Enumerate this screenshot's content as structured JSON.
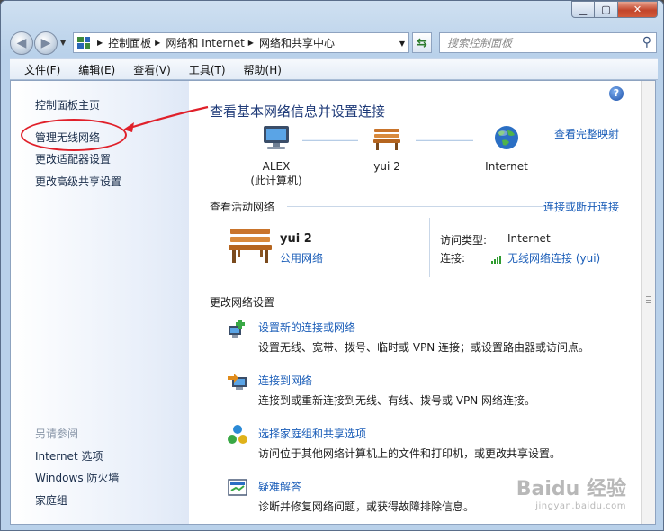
{
  "address": {
    "crumbs": [
      "控制面板",
      "网络和 Internet",
      "网络和共享中心"
    ],
    "search_placeholder": "搜索控制面板"
  },
  "menu": [
    "文件(F)",
    "编辑(E)",
    "查看(V)",
    "工具(T)",
    "帮助(H)"
  ],
  "sidebar": {
    "links": [
      "控制面板主页",
      "管理无线网络",
      "更改适配器设置",
      "更改高级共享设置"
    ],
    "see_also_heading": "另请参阅",
    "see_also": [
      "Internet 选项",
      "Windows 防火墙",
      "家庭组"
    ]
  },
  "main": {
    "title": "查看基本网络信息并设置连接",
    "full_map_link": "查看完整映射",
    "nodes": [
      {
        "name": "ALEX",
        "sub": "(此计算机)"
      },
      {
        "name": "yui  2",
        "sub": ""
      },
      {
        "name": "Internet",
        "sub": ""
      }
    ],
    "active_heading": "查看活动网络",
    "connect_toggle": "连接或断开连接",
    "active_network": {
      "name": "yui  2",
      "category": "公用网络",
      "access_label": "访问类型:",
      "access_value": "Internet",
      "connection_label": "连接:",
      "connection_value": "无线网络连接 (yui)"
    },
    "change_heading": "更改网络设置",
    "tasks": [
      {
        "title": "设置新的连接或网络",
        "desc": "设置无线、宽带、拨号、临时或 VPN 连接；或设置路由器或访问点。"
      },
      {
        "title": "连接到网络",
        "desc": "连接到或重新连接到无线、有线、拨号或 VPN 网络连接。"
      },
      {
        "title": "选择家庭组和共享选项",
        "desc": "访问位于其他网络计算机上的文件和打印机，或更改共享设置。"
      },
      {
        "title": "疑难解答",
        "desc": "诊断并修复网络问题，或获得故障排除信息。"
      }
    ]
  },
  "watermark": {
    "main": "Baidu 经验",
    "sub": "jingyan.baidu.com"
  },
  "colors": {
    "link": "#1a5db8",
    "title": "#1e3a78",
    "annotation": "#e0202a"
  }
}
